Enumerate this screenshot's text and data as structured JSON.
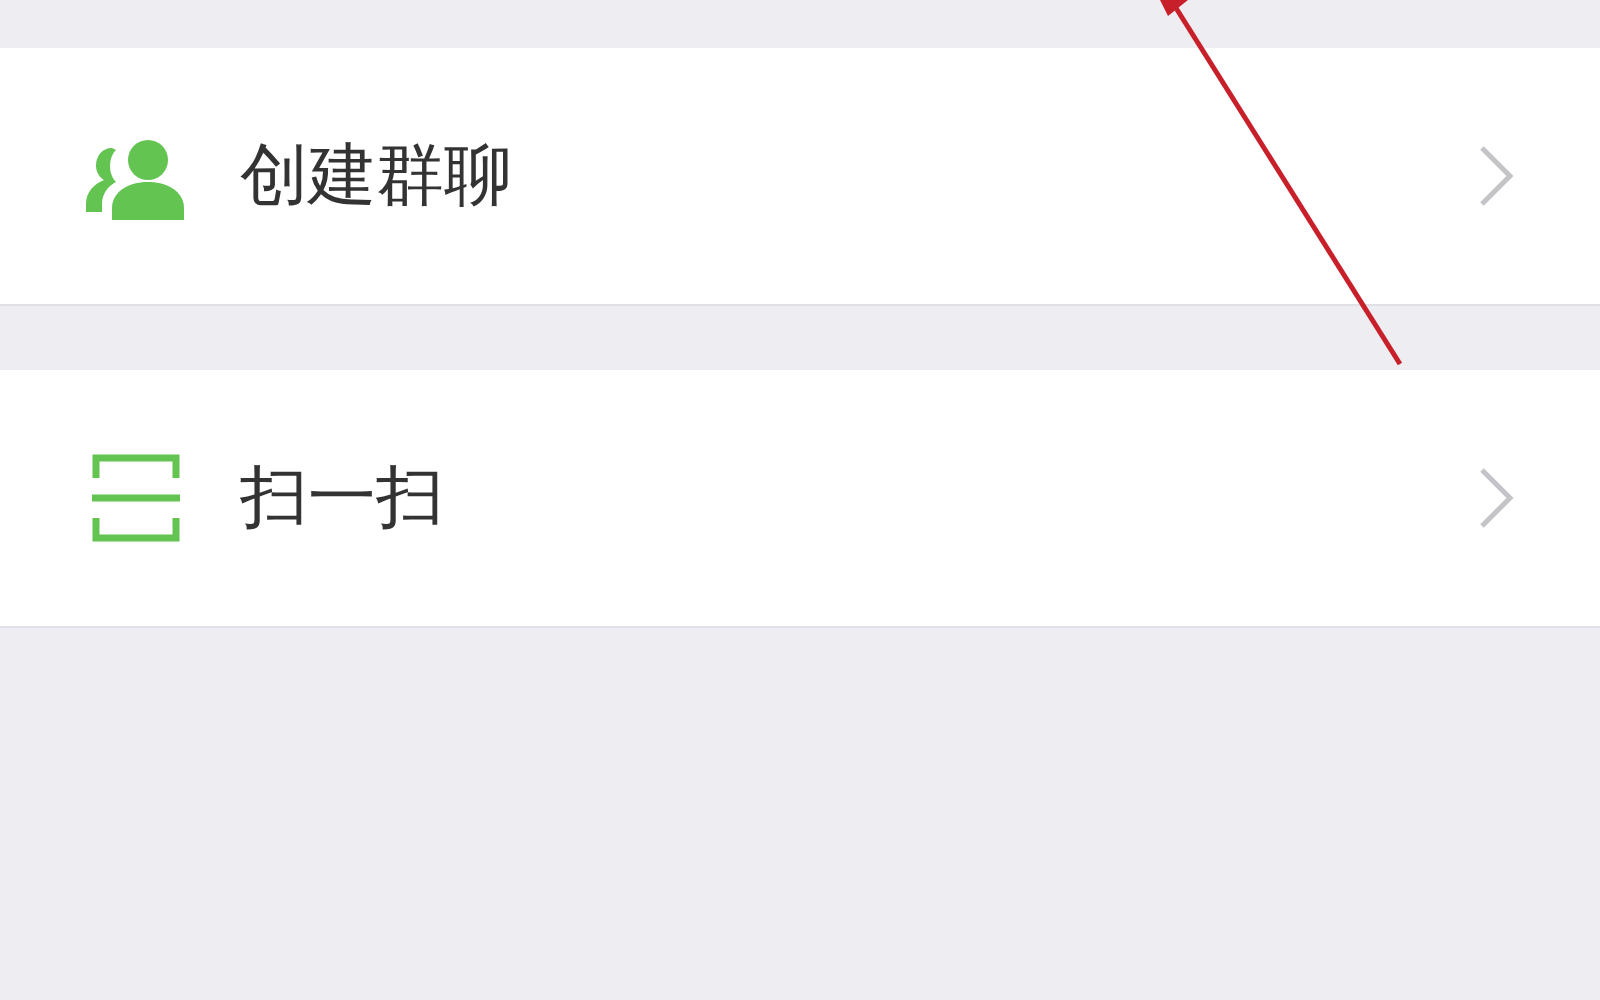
{
  "menu_items": [
    {
      "label": "创建群聊",
      "kind": "group"
    },
    {
      "label": "扫一扫",
      "kind": "scan"
    }
  ]
}
